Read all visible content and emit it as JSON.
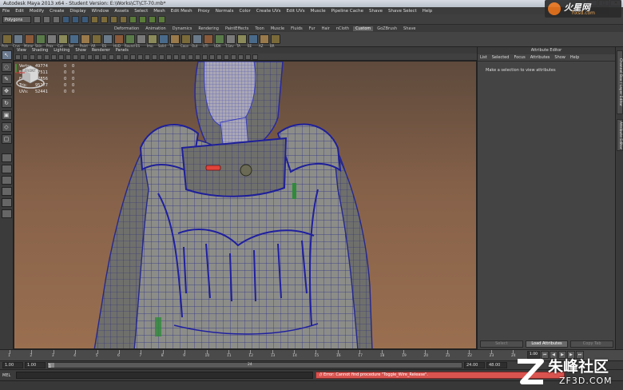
{
  "window": {
    "title": "Autodesk Maya 2013 x64 - Student Version: E:\\Works\\CT\\CT-70.mb*",
    "controls": [
      "_",
      "□",
      "✕"
    ]
  },
  "menus": [
    "File",
    "Edit",
    "Modify",
    "Create",
    "Display",
    "Window",
    "Assets",
    "Select",
    "Mesh",
    "Edit Mesh",
    "Proxy",
    "Normals",
    "Color",
    "Create UVs",
    "Edit UVs",
    "Muscle",
    "Pipeline Cache",
    "Shave",
    "Shave Select",
    "Help"
  ],
  "status_line": {
    "mode": "Polygons"
  },
  "shelf": {
    "tabs": [
      "Deformation",
      "Animation",
      "Dynamics",
      "Rendering",
      "PaintEffects",
      "Toon",
      "Muscle",
      "Fluids",
      "Fur",
      "Hair",
      "nCloth",
      "Custom",
      "GoZBrush",
      "Shave"
    ],
    "active_tab": "Custom",
    "icons": [
      "Poly",
      "Crvs",
      "Mirror",
      "Skin",
      "Prox",
      "Cut",
      "Sel",
      "Paint",
      "AR",
      "ES",
      "HUD",
      "Round",
      "ES",
      "Imp",
      "Solid",
      "TX",
      "Copy",
      "Out",
      "UTI",
      "UDK",
      "T.Sev",
      "TA",
      "EE",
      "AZ",
      "BR"
    ]
  },
  "viewport": {
    "menus": [
      "View",
      "Shading",
      "Lighting",
      "Show",
      "Renderer",
      "Panels"
    ],
    "hud": [
      {
        "label": "Verts:",
        "value": "49774",
        "a": "0",
        "b": "0"
      },
      {
        "label": "Edges:",
        "value": "97511",
        "a": "0",
        "b": "0"
      },
      {
        "label": "Faces:",
        "value": "47856",
        "a": "0",
        "b": "0"
      },
      {
        "label": "Tris:",
        "value": "95277",
        "a": "0",
        "b": "0"
      },
      {
        "label": "UVs:",
        "value": "52441",
        "a": "0",
        "b": "0"
      }
    ],
    "viewcube_label": "FRONT"
  },
  "attribute_editor": {
    "title": "Attribute Editor",
    "menus": [
      "List",
      "Selected",
      "Focus",
      "Attributes",
      "Show",
      "Help"
    ],
    "message": "Make a selection to view attributes",
    "buttons": {
      "select": "Select",
      "load": "Load Attributes",
      "copy": "Copy Tab"
    }
  },
  "side_tabs": [
    "Channel Box / Layer Editor",
    "Attribute Editor"
  ],
  "time_slider": {
    "ticks": [
      "1",
      "2",
      "3",
      "4",
      "5",
      "6",
      "7",
      "8",
      "9",
      "10",
      "11",
      "12",
      "13",
      "14",
      "15",
      "16",
      "17",
      "18",
      "19",
      "20",
      "21",
      "22",
      "23",
      "24"
    ],
    "current_frame": "1.00"
  },
  "range_slider": {
    "start": "1.00",
    "inner_start": "1.00",
    "range_start": "1",
    "range_mid": "24",
    "inner_end": "24.00",
    "end": "48.00"
  },
  "command_line": {
    "label": "MEL",
    "error": "// Error: Cannot find procedure \"Toggle_Wire_Release\"."
  },
  "watermarks": {
    "top_cn": "火星网",
    "top_en": "hxsd.com",
    "bottom_cn": "朱峰社区",
    "bottom_en": "ZF3D.COM"
  }
}
